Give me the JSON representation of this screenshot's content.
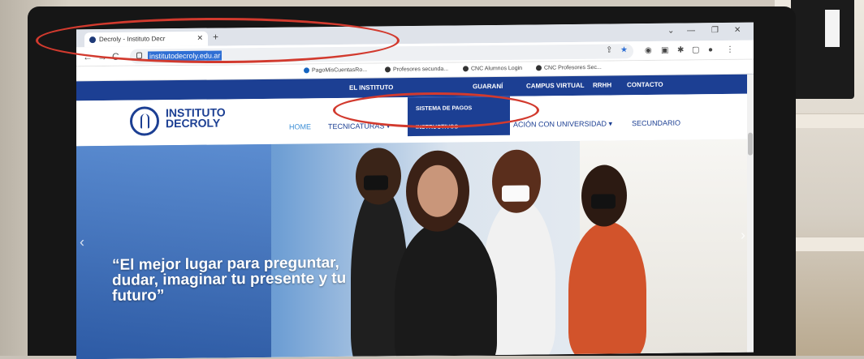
{
  "browser": {
    "tab_title": "Decroly - Instituto Decr",
    "url": "institutodecroly.edu.ar",
    "bookmarks": [
      "PagoMisCuentasRo...",
      "Profesores secunda...",
      "CNC Alumnos Login",
      "CNC Profesores Sec..."
    ]
  },
  "site": {
    "logo_line1": "INSTITUTO",
    "logo_line2": "DECROLY",
    "top_nav": [
      "EL INSTITUTO",
      "GUARANÍ",
      "CAMPUS VIRTUAL",
      "RRHH",
      "CONTACTO"
    ],
    "dropdown": [
      "SISTEMA DE PAGOS",
      "INSTRUCTIVOS"
    ],
    "main_nav": [
      "HOME",
      "TECNICATURAS ▾",
      "ACIÓN CON UNIVERSIDAD ▾",
      "SECUNDARIO"
    ],
    "hero_slogan": "“El mejor lugar para preguntar, dudar, imaginar tu presente y tu futuro”"
  },
  "colors": {
    "brand_blue": "#1c3f93",
    "annotation_red": "#d23a2e",
    "url_highlight": "#2f6fd4"
  }
}
